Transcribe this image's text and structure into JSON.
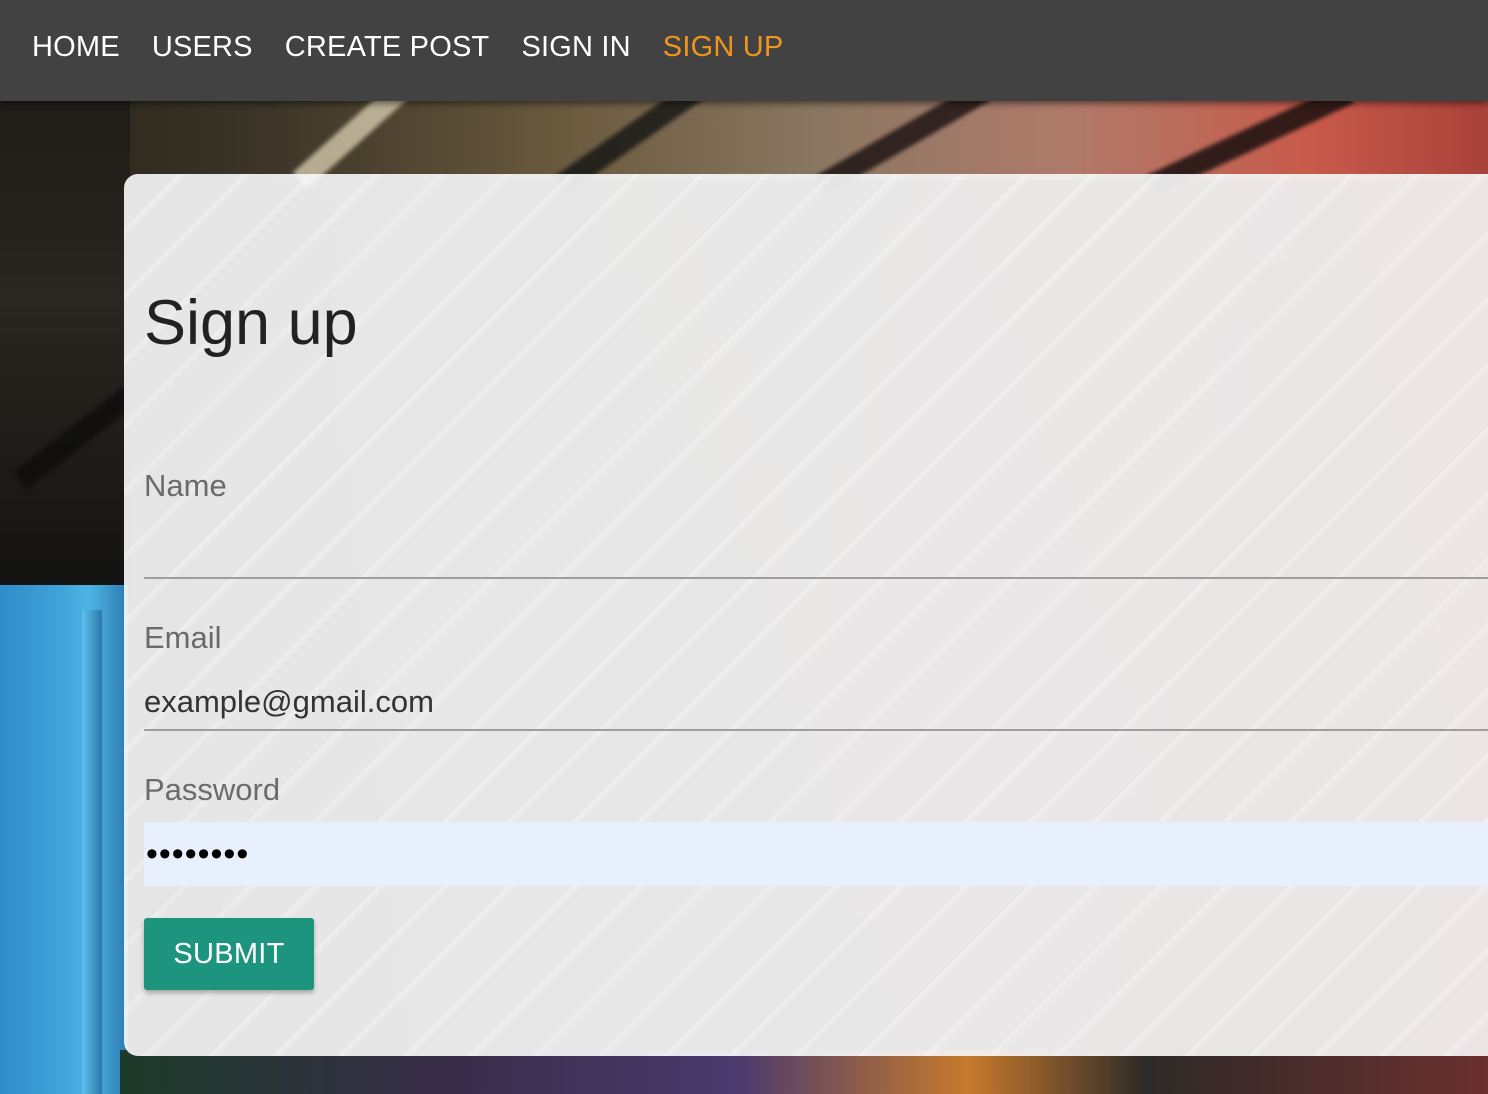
{
  "nav": {
    "items": [
      {
        "label": "HOME",
        "active": false
      },
      {
        "label": "USERS",
        "active": false
      },
      {
        "label": "CREATE POST",
        "active": false
      },
      {
        "label": "SIGN IN",
        "active": false
      },
      {
        "label": "SIGN UP",
        "active": true
      }
    ],
    "active_color": "#f0951c",
    "background_color": "#424242"
  },
  "form": {
    "title": "Sign up",
    "fields": {
      "name": {
        "label": "Name",
        "value": ""
      },
      "email": {
        "label": "Email",
        "value": "example@gmail.com"
      },
      "password": {
        "label": "Password",
        "value": "••••••••"
      }
    },
    "submit_label": "SUBMIT",
    "submit_color": "#1d957e"
  }
}
